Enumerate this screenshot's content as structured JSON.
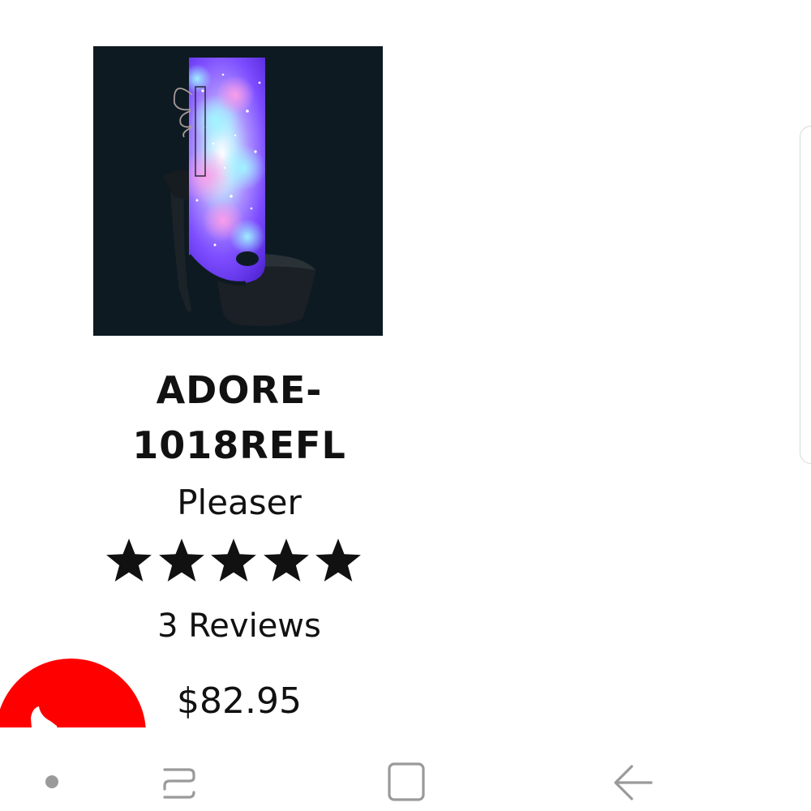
{
  "product": {
    "name": "ADORE-\n1018REFL",
    "brand": "Pleaser",
    "rating": 5,
    "rating_max": 5,
    "reviews": "3 Reviews",
    "price": "$82.95"
  },
  "colors": {
    "fab": "#fe0000",
    "image_background": "#0e1a22",
    "text": "#111111",
    "nav_icon": "#9a9a9a"
  },
  "icons": {
    "fab": "shoe-icon",
    "nav_recents": "recents-icon",
    "nav_home": "home-icon",
    "nav_back": "back-icon"
  }
}
